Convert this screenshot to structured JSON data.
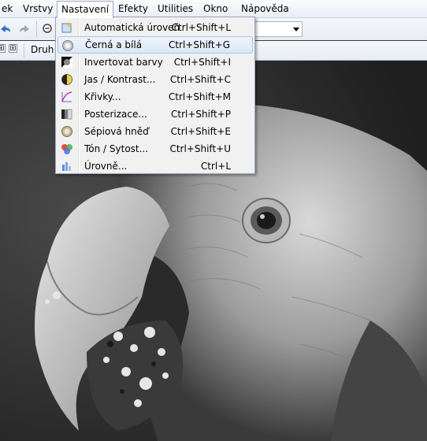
{
  "menubar": {
    "items": [
      {
        "label": "ek"
      },
      {
        "label": "Vrstvy"
      },
      {
        "label": "Nastavení"
      },
      {
        "label": "Efekty"
      },
      {
        "label": "Utilities"
      },
      {
        "label": "Okno"
      },
      {
        "label": "Nápověda"
      }
    ],
    "open_item": "Nastavení"
  },
  "toolbar2": {
    "druh_label": "Druh v",
    "plus_symbol": "⊞"
  },
  "menu": {
    "items": [
      {
        "label": "Automatická úroveň",
        "shortcut": "Ctrl+Shift+L",
        "icon": "auto-level-icon"
      },
      {
        "label": "Černá a bílá",
        "shortcut": "Ctrl+Shift+G",
        "icon": "black-white-icon",
        "highlighted": true
      },
      {
        "label": "Invertovat barvy",
        "shortcut": "Ctrl+Shift+I",
        "icon": "invert-colors-icon"
      },
      {
        "label": "Jas / Kontrast...",
        "shortcut": "Ctrl+Shift+C",
        "icon": "brightness-contrast-icon"
      },
      {
        "label": "Křivky...",
        "shortcut": "Ctrl+Shift+M",
        "icon": "curves-icon"
      },
      {
        "label": "Posterizace...",
        "shortcut": "Ctrl+Shift+P",
        "icon": "posterize-icon"
      },
      {
        "label": "Sépiová hněď",
        "shortcut": "Ctrl+Shift+E",
        "icon": "sepia-icon"
      },
      {
        "label": "Tón / Sytost...",
        "shortcut": "Ctrl+Shift+U",
        "icon": "hue-saturation-icon"
      },
      {
        "label": "Úrovně...",
        "shortcut": "Ctrl+L",
        "icon": "levels-icon"
      }
    ]
  },
  "canvas": {
    "image": "grayscale-parrot-photo"
  },
  "colors": {
    "menu_highlight": "#dbe8f7",
    "menu_bg": "#f1f1f1",
    "toolbar_bg": "#e9eef6"
  }
}
